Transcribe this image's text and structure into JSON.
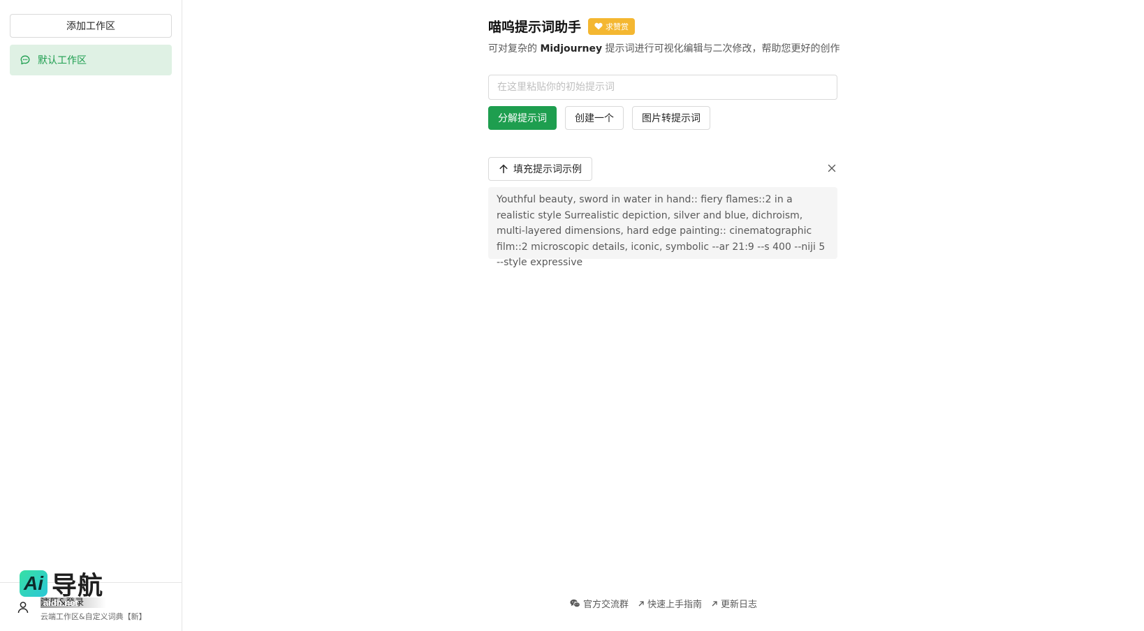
{
  "sidebar": {
    "add_workspace_label": "添加工作区",
    "workspaces": [
      {
        "label": "默认工作区",
        "active": true
      }
    ],
    "footer": {
      "login_label": "注册&登录",
      "login_subtitle": "云端工作区&自定义词典【新】"
    },
    "watermark": {
      "badge": "Ai",
      "text": "导航",
      "url": "aidh.net"
    }
  },
  "header": {
    "title": "喵呜提示词助手",
    "sponsor_label": "求赞赏",
    "subtitle_prefix": "可对复杂的",
    "subtitle_brand": "Midjourney",
    "subtitle_suffix": "提示词进行可视化编辑与二次修改，帮助您更好的创作"
  },
  "prompt_input": {
    "placeholder": "在这里粘贴你的初始提示词",
    "value": ""
  },
  "actions": {
    "decompose_label": "分解提示词",
    "create_label": "创建一个",
    "image_to_prompt_label": "图片转提示词"
  },
  "example": {
    "fill_label": "填充提示词示例",
    "text": "Youthful beauty, sword in water in hand:: fiery flames::2 in a realistic style Surrealistic depiction, silver and blue, dichroism, multi-layered dimensions, hard edge painting:: cinematographic film::2 microscopic details, iconic, symbolic --ar 21:9 --s 400 --niji 5 --style expressive"
  },
  "footer": {
    "community_label": "官方交流群",
    "guide_label": "快速上手指南",
    "changelog_label": "更新日志"
  },
  "colors": {
    "accent": "#1e9e4f",
    "active_bg": "#dff1e4",
    "sponsor": "#f4b731"
  }
}
